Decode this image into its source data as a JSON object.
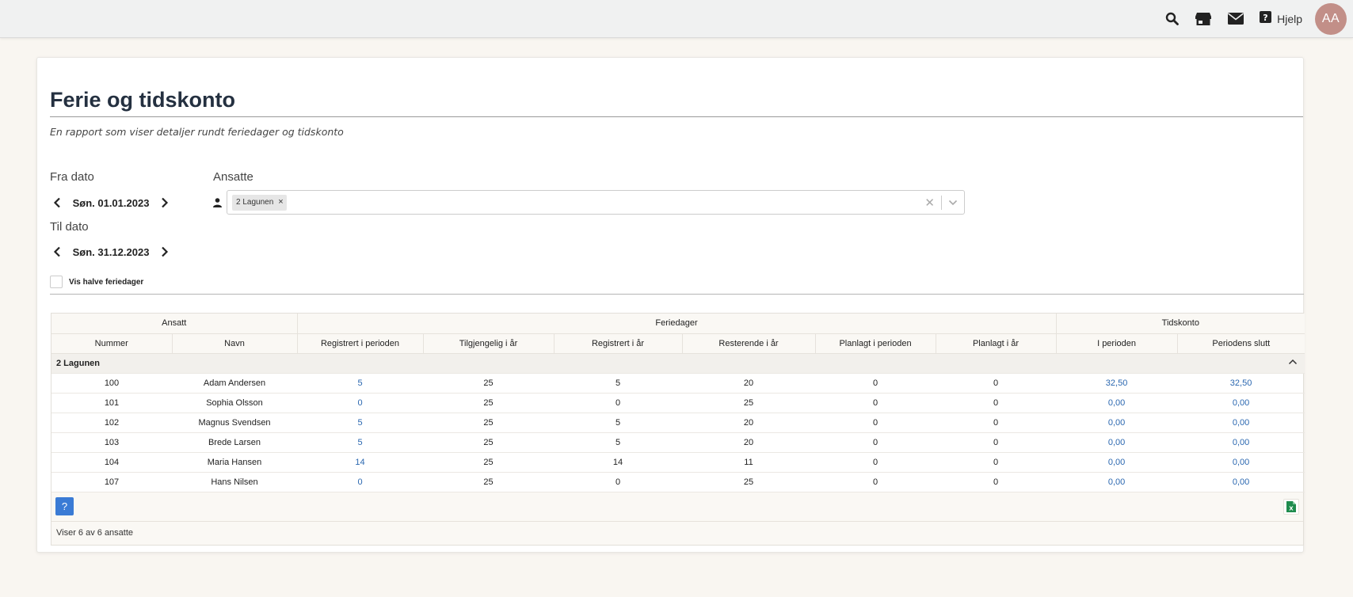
{
  "topbar": {
    "help_label": "Hjelp",
    "avatar_initials": "AA",
    "icons": [
      "search-icon",
      "store-icon",
      "mail-icon",
      "question-icon"
    ]
  },
  "page": {
    "title": "Ferie og tidskonto",
    "subtitle": "En rapport som viser detaljer rundt feriedager og tidskonto"
  },
  "filters": {
    "from_label": "Fra dato",
    "from_value": "Søn. 01.01.2023",
    "to_label": "Til dato",
    "to_value": "Søn. 31.12.2023",
    "employees_label": "Ansatte",
    "employees_chip": "2 Lagunen",
    "half_days_label": "Vis halve feriedager",
    "half_days_checked": false
  },
  "grid": {
    "group_headers": [
      "Ansatt",
      "Feriedager",
      "Tidskonto"
    ],
    "columns": [
      "Nummer",
      "Navn",
      "Registrert i perioden",
      "Tilgjengelig i år",
      "Registrert i år",
      "Resterende i år",
      "Planlagt i perioden",
      "Planlagt i år",
      "I perioden",
      "Periodens slutt"
    ],
    "group_name": "2 Lagunen",
    "rows": [
      [
        "100",
        "Adam Andersen",
        "5",
        "25",
        "5",
        "20",
        "0",
        "0",
        "32,50",
        "32,50"
      ],
      [
        "101",
        "Sophia Olsson",
        "0",
        "25",
        "0",
        "25",
        "0",
        "0",
        "0,00",
        "0,00"
      ],
      [
        "102",
        "Magnus Svendsen",
        "5",
        "25",
        "5",
        "20",
        "0",
        "0",
        "0,00",
        "0,00"
      ],
      [
        "103",
        "Brede Larsen",
        "5",
        "25",
        "5",
        "20",
        "0",
        "0",
        "0,00",
        "0,00"
      ],
      [
        "104",
        "Maria Hansen",
        "14",
        "25",
        "14",
        "11",
        "0",
        "0",
        "0,00",
        "0,00"
      ],
      [
        "107",
        "Hans Nilsen",
        "0",
        "25",
        "0",
        "25",
        "0",
        "0",
        "0,00",
        "0,00"
      ]
    ],
    "help_button": "?",
    "status": "Viser 6 av 6 ansatte"
  },
  "colors": {
    "link": "#2a67b0",
    "help_button": "#3a7bd5",
    "avatar": "#c28f88",
    "title": "#243040"
  }
}
